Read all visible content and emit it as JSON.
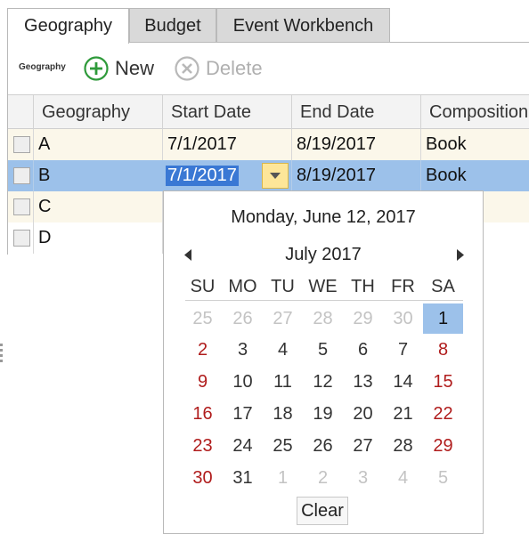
{
  "tabs": [
    {
      "label": "Geography",
      "active": true
    },
    {
      "label": "Budget",
      "active": false
    },
    {
      "label": "Event Workbench",
      "active": false
    }
  ],
  "toolbar": {
    "section_label": "Geography",
    "new_label": "New",
    "delete_label": "Delete",
    "new_icon": "plus-circle-icon",
    "delete_icon": "x-circle-icon"
  },
  "grid": {
    "columns": [
      "Geography",
      "Start Date",
      "End Date",
      "Composition"
    ],
    "rows": [
      {
        "geography": "A",
        "start_date": "7/1/2017",
        "end_date": "8/19/2017",
        "composition": "Book"
      },
      {
        "geography": "B",
        "start_date": "7/1/2017",
        "end_date": "8/19/2017",
        "composition": "Book",
        "selected": true,
        "editing": "start_date"
      },
      {
        "geography": "C",
        "start_date": "",
        "end_date": "",
        "composition": ""
      },
      {
        "geography": "D",
        "start_date": "",
        "end_date": "",
        "composition": ""
      }
    ]
  },
  "calendar": {
    "today_label": "Monday, June 12, 2017",
    "month_label": "July 2017",
    "weekdays": [
      "SU",
      "MO",
      "TU",
      "WE",
      "TH",
      "FR",
      "SA"
    ],
    "weeks": [
      [
        "25",
        "26",
        "27",
        "28",
        "29",
        "30",
        "1"
      ],
      [
        "2",
        "3",
        "4",
        "5",
        "6",
        "7",
        "8"
      ],
      [
        "9",
        "10",
        "11",
        "12",
        "13",
        "14",
        "15"
      ],
      [
        "16",
        "17",
        "18",
        "19",
        "20",
        "21",
        "22"
      ],
      [
        "23",
        "24",
        "25",
        "26",
        "27",
        "28",
        "29"
      ],
      [
        "30",
        "31",
        "1",
        "2",
        "3",
        "4",
        "5"
      ]
    ],
    "selected_day": "1",
    "clear_label": "Clear"
  },
  "colors": {
    "selection": "#9cc1ea",
    "weekend": "#b01c1c",
    "new_icon": "#2e9a3a",
    "row_alt": "#fbf7ea"
  }
}
